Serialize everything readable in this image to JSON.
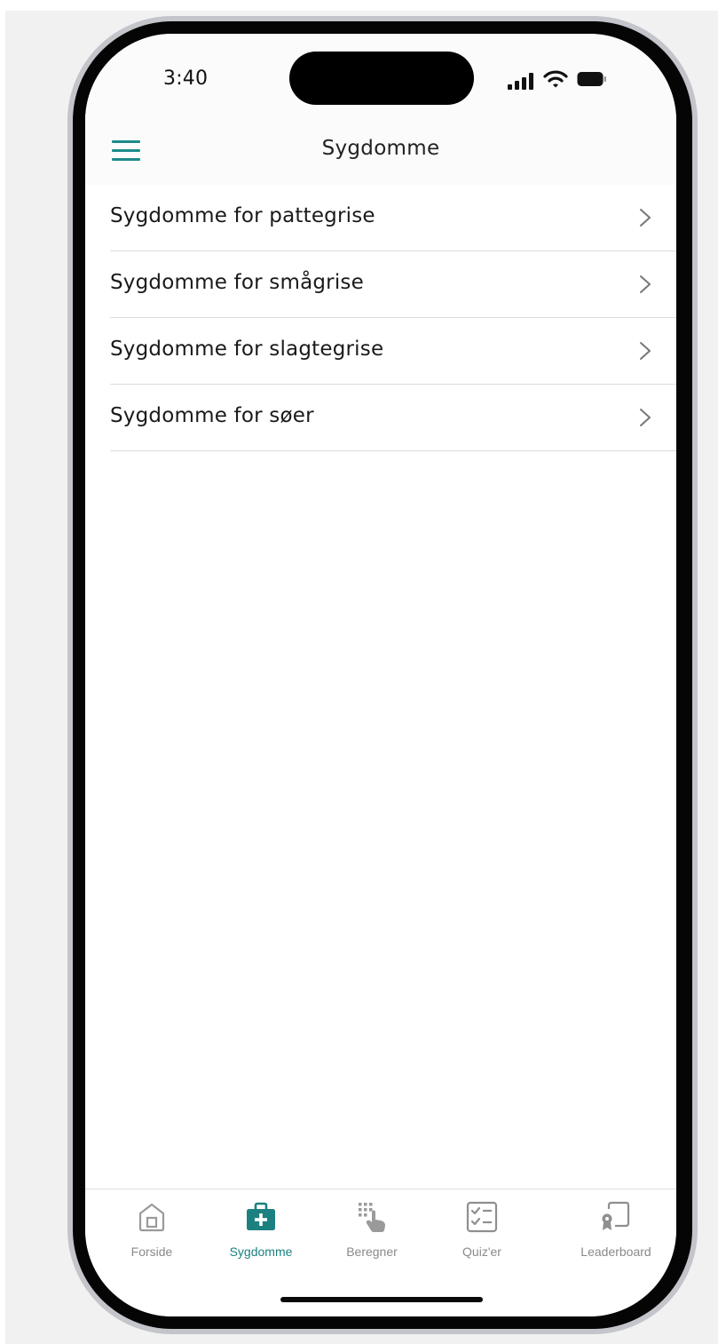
{
  "status_bar": {
    "time": "3:40"
  },
  "header": {
    "title": "Sygdomme"
  },
  "list": {
    "items": [
      {
        "label": "Sygdomme for pattegrise"
      },
      {
        "label": "Sygdomme for smågrise"
      },
      {
        "label": "Sygdomme for slagtegrise"
      },
      {
        "label": "Sygdomme for søer"
      }
    ]
  },
  "tabbar": {
    "active_index": 1,
    "tabs": [
      {
        "label": "Forside",
        "icon": "home-icon"
      },
      {
        "label": "Sygdomme",
        "icon": "first-aid-kit-icon"
      },
      {
        "label": "Beregner",
        "icon": "keypad-touch-icon"
      },
      {
        "label": "Quiz'er",
        "icon": "checklist-icon"
      },
      {
        "label": "Leaderboard",
        "icon": "certificate-icon"
      }
    ]
  },
  "colors": {
    "accent": "#1d8a8a",
    "inactive": "#8a8a8a",
    "text": "#1a1a1a"
  }
}
